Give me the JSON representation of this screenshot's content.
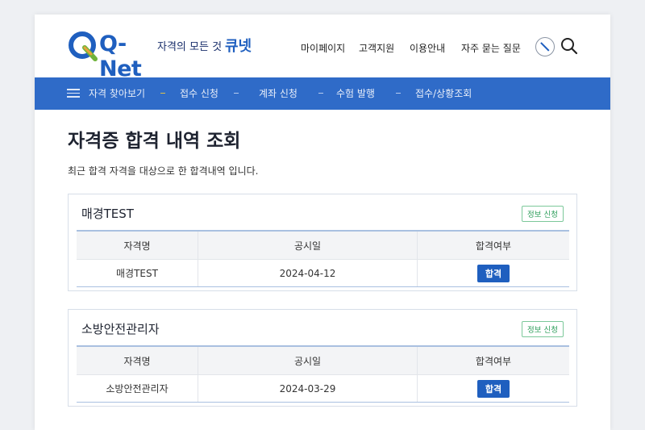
{
  "header": {
    "logo_text": "Q-Net",
    "tagline": "자격의 모든 것",
    "tagline_brand": "큐넷",
    "nav": [
      "마이페이지",
      "고객지원",
      "이용안내",
      "자주 묻는 질문"
    ]
  },
  "menubar": {
    "items": [
      "자격 찾아보기",
      "접수 신청",
      "계좌 신청",
      "수험 발행",
      "접수/상황조회"
    ]
  },
  "main": {
    "title": "자격증 합격 내역 조회",
    "subtitle": "최근 합격 자격을 대상으로 한 합격내역 입니다."
  },
  "table_headers": {
    "col1": "자격명",
    "col2": "공시일",
    "col3": "합격여부"
  },
  "cards": [
    {
      "name": "매경TEST",
      "badge": "정보 신청",
      "row": {
        "name": "매경TEST",
        "date": "2024-04-12",
        "status": "합격"
      }
    },
    {
      "name": "소방안전관리자",
      "badge": "정보 신청",
      "row": {
        "name": "소방안전관리자",
        "date": "2024-03-29",
        "status": "합격"
      }
    }
  ],
  "colors": {
    "brand_blue": "#1f5fbf",
    "menubar_blue": "#2f6bc8",
    "badge_green": "#2e9e5b"
  }
}
